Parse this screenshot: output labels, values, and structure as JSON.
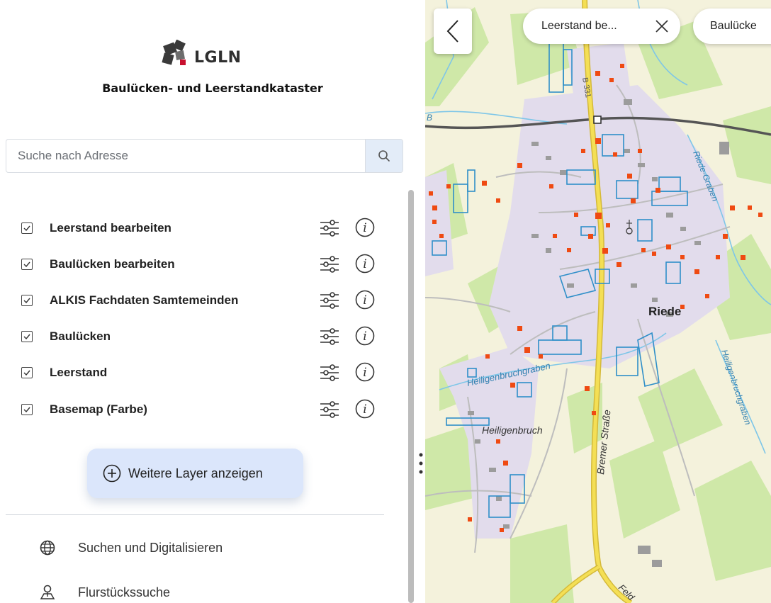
{
  "sidebar": {
    "logo_text": "LGLN",
    "title": "Baulücken- und Leerstandkataster",
    "search": {
      "placeholder": "Suche nach Adresse",
      "value": ""
    },
    "layers": [
      {
        "label": "Leerstand bearbeiten",
        "checked": true
      },
      {
        "label": "Baulücken bearbeiten",
        "checked": true
      },
      {
        "label": "ALKIS Fachdaten Samtemeinden",
        "checked": true
      },
      {
        "label": "Baulücken",
        "checked": true
      },
      {
        "label": "Leerstand",
        "checked": true
      },
      {
        "label": "Basemap (Farbe)",
        "checked": true
      }
    ],
    "more_layers_label": "Weitere Layer anzeigen",
    "nav": [
      {
        "label": "Suchen und Digitalisieren",
        "icon": "globe-icon"
      },
      {
        "label": "Flurstückssuche",
        "icon": "parcel-search-icon"
      }
    ]
  },
  "map": {
    "tabs": [
      {
        "label": "Leerstand be...",
        "closable": true
      },
      {
        "label": "Baulücke",
        "closable": false
      }
    ],
    "labels": {
      "town": "Riede",
      "village": "Heiligenbruch",
      "street": "Bremer Straße",
      "stream1": "Heiligenbruchgraben",
      "stream2": "Heiligenbruchgraben",
      "stream3": "Riede-Graben",
      "road_no": "B 331",
      "misc1": "B",
      "road_end": "Feld"
    }
  },
  "colors": {
    "accent": "#dbe6fb",
    "leerstand": "#ef4a12",
    "baulücken": "#2f8fc9",
    "road_main": "#f0d94a"
  }
}
